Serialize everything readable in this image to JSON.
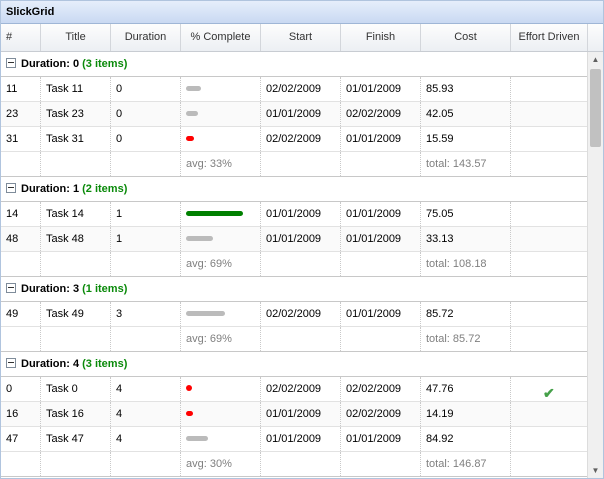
{
  "title": "SlickGrid",
  "columns": [
    "#",
    "Title",
    "Duration",
    "% Complete",
    "Start",
    "Finish",
    "Cost",
    "Effort Driven"
  ],
  "colors": {
    "bar_low": "#bbbbbb",
    "bar_red": "#ff0000",
    "bar_green": "#008000",
    "count_green": "#0a8a0a",
    "check_green": "#45a049"
  },
  "groups": [
    {
      "label": "Duration: 0",
      "count": "(3 items)",
      "rows": [
        {
          "id": "11",
          "title": "Task 11",
          "duration": "0",
          "pct": 0.25,
          "bar": "bar_low",
          "start": "02/02/2009",
          "finish": "01/01/2009",
          "cost": "85.93",
          "effort": false
        },
        {
          "id": "23",
          "title": "Task 23",
          "duration": "0",
          "pct": 0.2,
          "bar": "bar_low",
          "start": "01/01/2009",
          "finish": "02/02/2009",
          "cost": "42.05",
          "effort": false
        },
        {
          "id": "31",
          "title": "Task 31",
          "duration": "0",
          "pct": 0.13,
          "bar": "bar_red",
          "start": "02/02/2009",
          "finish": "01/01/2009",
          "cost": "15.59",
          "effort": false
        }
      ],
      "avg": "avg: 33%",
      "total": "total: 143.57"
    },
    {
      "label": "Duration: 1",
      "count": "(2 items)",
      "rows": [
        {
          "id": "14",
          "title": "Task 14",
          "duration": "1",
          "pct": 0.95,
          "bar": "bar_green",
          "start": "01/01/2009",
          "finish": "01/01/2009",
          "cost": "75.05",
          "effort": false
        },
        {
          "id": "48",
          "title": "Task 48",
          "duration": "1",
          "pct": 0.45,
          "bar": "bar_low",
          "start": "01/01/2009",
          "finish": "01/01/2009",
          "cost": "33.13",
          "effort": false
        }
      ],
      "avg": "avg: 69%",
      "total": "total: 108.18"
    },
    {
      "label": "Duration: 3",
      "count": "(1 items)",
      "rows": [
        {
          "id": "49",
          "title": "Task 49",
          "duration": "3",
          "pct": 0.65,
          "bar": "bar_low",
          "start": "02/02/2009",
          "finish": "01/01/2009",
          "cost": "85.72",
          "effort": false
        }
      ],
      "avg": "avg: 69%",
      "total": "total: 85.72"
    },
    {
      "label": "Duration: 4",
      "count": "(3 items)",
      "rows": [
        {
          "id": "0",
          "title": "Task 0",
          "duration": "4",
          "pct": 0.05,
          "bar": "bar_red",
          "start": "02/02/2009",
          "finish": "02/02/2009",
          "cost": "47.76",
          "effort": true
        },
        {
          "id": "16",
          "title": "Task 16",
          "duration": "4",
          "pct": 0.12,
          "bar": "bar_red",
          "start": "01/01/2009",
          "finish": "02/02/2009",
          "cost": "14.19",
          "effort": false
        },
        {
          "id": "47",
          "title": "Task 47",
          "duration": "4",
          "pct": 0.37,
          "bar": "bar_low",
          "start": "01/01/2009",
          "finish": "01/01/2009",
          "cost": "84.92",
          "effort": false
        }
      ],
      "avg": "avg: 30%",
      "total": "total: 146.87"
    }
  ]
}
